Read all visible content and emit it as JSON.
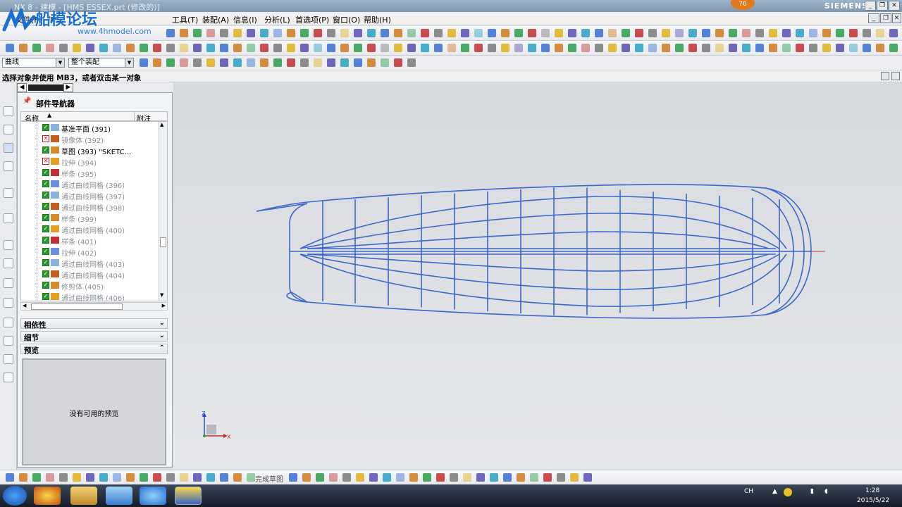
{
  "titlebar": {
    "title": "NX 8 - 建模 - [HMS ESSEX.prt (修改的)]",
    "brand": "SIEMENS",
    "badge": "70"
  },
  "watermark": {
    "name": "船模论坛",
    "url": "www.4hmodel.com"
  },
  "menu": {
    "file": "文件(F)",
    "edit": "编辑",
    "tools": "工具(T)",
    "assembly": "装配(A)",
    "info": "信息(I)",
    "analysis": "分析(L)",
    "preferences": "首选项(P)",
    "window": "窗口(O)",
    "help": "帮助(H)"
  },
  "selection": {
    "filter": "曲线",
    "scope": "整个装配"
  },
  "status": {
    "prompt": "选择对象并使用 MB3，或者双击某一对象"
  },
  "navigator": {
    "title": "部件导航器",
    "col_name": "名称",
    "col_note": "附注",
    "rows": [
      {
        "label": "基准平面 (391)",
        "state": "on",
        "dim": false
      },
      {
        "label": "镜像体 (392)",
        "state": "off",
        "dim": true
      },
      {
        "label": "草图 (393) \"SKETC...",
        "state": "on",
        "dim": false
      },
      {
        "label": "拉伸 (394)",
        "state": "off",
        "dim": true
      },
      {
        "label": "样条 (395)",
        "state": "on",
        "dim": true
      },
      {
        "label": "通过曲线网格 (396)",
        "state": "on",
        "dim": true
      },
      {
        "label": "通过曲线网格 (397)",
        "state": "on",
        "dim": true
      },
      {
        "label": "通过曲线网格 (398)",
        "state": "on",
        "dim": true
      },
      {
        "label": "样条 (399)",
        "state": "on",
        "dim": true
      },
      {
        "label": "通过曲线网格 (400)",
        "state": "on",
        "dim": true
      },
      {
        "label": "样条 (401)",
        "state": "on",
        "dim": true
      },
      {
        "label": "拉伸 (402)",
        "state": "on",
        "dim": true
      },
      {
        "label": "通过曲线网格 (403)",
        "state": "on",
        "dim": true
      },
      {
        "label": "通过曲线网格 (404)",
        "state": "on",
        "dim": true
      },
      {
        "label": "修剪体 (405)",
        "state": "on",
        "dim": true
      },
      {
        "label": "通过曲线网格 (406)",
        "state": "on",
        "dim": true
      }
    ],
    "panels": {
      "dependencies": "相依性",
      "details": "细节",
      "preview": "预览"
    },
    "preview_text": "没有可用的预览"
  },
  "viewport": {
    "axis_z": "Z",
    "axis_x": "X",
    "curve_color": "#3c66cc"
  },
  "bottom_toolbar": {
    "finish_sketch": "完成草图"
  },
  "taskbar": {
    "lang": "CH",
    "time": "1:28",
    "date": "2015/5/22"
  }
}
